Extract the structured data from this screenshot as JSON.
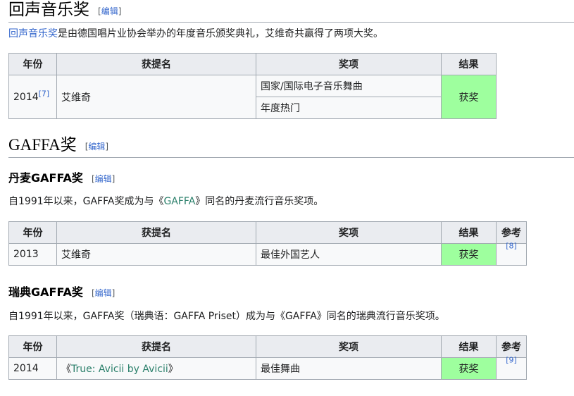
{
  "edit_label": "编辑",
  "s1": {
    "title": "回声音乐奖",
    "intro_link": "回声音乐奖",
    "intro_rest": "是由德国唱片业协会举办的年度音乐颁奖典礼，艾维奇共赢得了两项大奖。",
    "headers": [
      "年份",
      "获提名",
      "奖项",
      "结果"
    ],
    "row": {
      "year": "2014",
      "ref": "[7]",
      "nominee": "艾维奇",
      "awards": [
        "国家/国际电子音乐舞曲",
        "年度热门"
      ],
      "result": "获奖"
    }
  },
  "s2": {
    "title": "GAFFA奖"
  },
  "s3": {
    "title": "丹麦GAFFA奖",
    "intro_pre": "自1991年以来，GAFFA奖成为与《",
    "intro_link": "GAFFA",
    "intro_post": "》同名的丹麦流行音乐奖项。",
    "headers": [
      "年份",
      "获提名",
      "奖项",
      "结果",
      "参考"
    ],
    "row": {
      "year": "2013",
      "nominee": "艾维奇",
      "award": "最佳外国艺人",
      "result": "获奖",
      "ref": "[8]"
    }
  },
  "s4": {
    "title": "瑞典GAFFA奖",
    "intro": "自1991年以来，GAFFA奖（瑞典语：GAFFA Priset）成为与《GAFFA》同名的瑞典流行音乐奖项。",
    "headers": [
      "年份",
      "获提名",
      "奖项",
      "结果",
      "参考"
    ],
    "row": {
      "year": "2014",
      "nominee_pre": "《",
      "nominee_link": "True: Avicii by Avicii",
      "nominee_post": "》",
      "award": "最佳舞曲",
      "result": "获奖",
      "ref": "[9]"
    }
  }
}
